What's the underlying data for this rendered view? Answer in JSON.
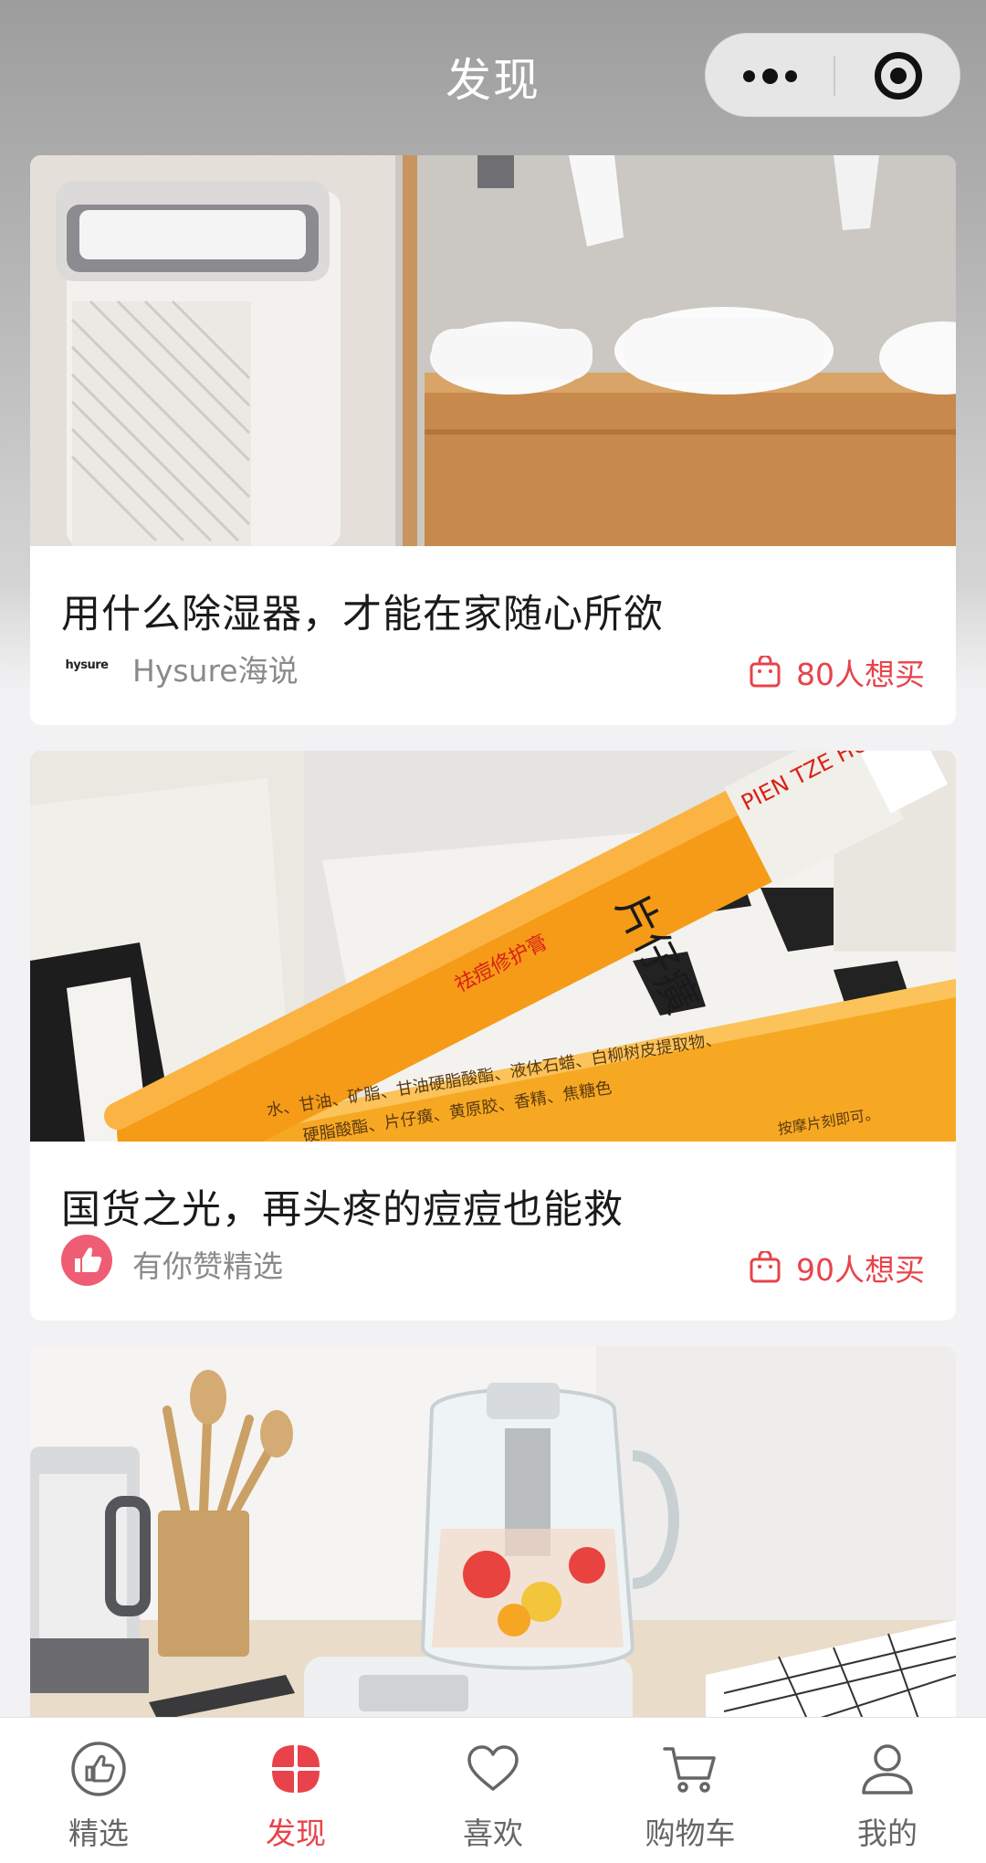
{
  "nav": {
    "title": "发现"
  },
  "cards": [
    {
      "title": "用什么除湿器，才能在家随心所欲",
      "brand": "Hysure海说",
      "brand_logo_text": "hysure",
      "want": "80人想买",
      "image": "dehumidifier-with-towels"
    },
    {
      "title": "国货之光，再头疼的痘痘也能救",
      "brand": "有你赞精选",
      "want": "90人想买",
      "image": "pien-tze-huang-ointment",
      "image_text": {
        "brand": "片仔癀",
        "brand_en": "PIEN TZE HUANG",
        "product": "祛痘修护膏",
        "ingredients_1": "水、甘油、矿脂、甘油硬脂酸酯、液体石蜡、白柳树皮提取物、",
        "ingredients_2": "硬脂酸酯、片仔癀、黄原胶、香精、焦糖色",
        "usage": "按摩片刻即可。"
      }
    },
    {
      "image": "kitchen-teapot-and-utensils"
    }
  ],
  "tabs": [
    {
      "label": "精选",
      "icon": "thumbs-up-icon",
      "active": false
    },
    {
      "label": "发现",
      "icon": "discover-petals-icon",
      "active": true
    },
    {
      "label": "喜欢",
      "icon": "heart-icon",
      "active": false
    },
    {
      "label": "购物车",
      "icon": "cart-icon",
      "active": false
    },
    {
      "label": "我的",
      "icon": "user-icon",
      "active": false
    }
  ],
  "colors": {
    "accent": "#e8434a",
    "tab_inactive": "#666666",
    "background": "#f2f2f4"
  }
}
